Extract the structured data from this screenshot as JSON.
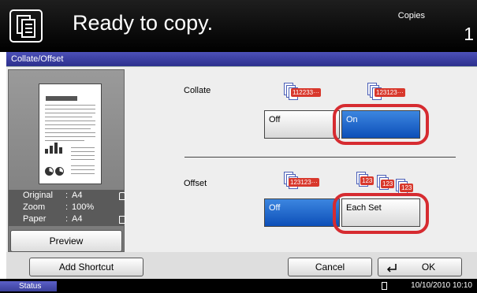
{
  "header": {
    "title": "Ready to copy.",
    "copies_label": "Copies",
    "copies_value": "1"
  },
  "panel": {
    "title": "Collate/Offset"
  },
  "preview": {
    "info": [
      {
        "label": "Original",
        "sep": ":",
        "value": "A4"
      },
      {
        "label": "Zoom",
        "sep": ":",
        "value": "100%"
      },
      {
        "label": "Paper",
        "sep": ":",
        "value": "A4"
      }
    ],
    "preview_button": "Preview"
  },
  "collate": {
    "label": "Collate",
    "off_label": "Off",
    "on_label": "On",
    "selected": "On",
    "icon_off_badge": "112233···",
    "icon_on_badge": "123123···"
  },
  "offset": {
    "label": "Offset",
    "off_label": "Off",
    "each_set_label": "Each Set",
    "selected": "Off",
    "icon_off_badge": "123123···",
    "icon_each_set_badges": [
      "123",
      "123",
      "123"
    ]
  },
  "footer": {
    "add_shortcut": "Add Shortcut",
    "cancel": "Cancel",
    "ok": "OK"
  },
  "status": {
    "status_label": "Status",
    "datetime": "10/10/2010  10:10"
  },
  "colors": {
    "accent_selected": "#1b5fc7",
    "highlight_ring": "#d62b30",
    "panel_header": "#3a3ea6"
  }
}
